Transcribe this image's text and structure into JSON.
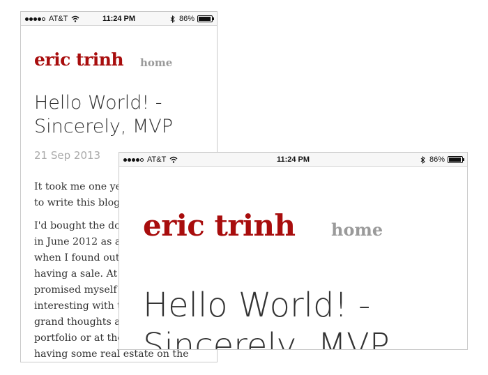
{
  "status_bar": {
    "carrier": "AT&T",
    "time": "11:24 PM",
    "battery_text": "86%",
    "battery_level_percent": 86,
    "signal_bars_filled": 4,
    "signal_bars_total": 5,
    "icons": [
      "signal-dots-icon",
      "wifi-icon",
      "bluetooth-icon",
      "battery-icon"
    ]
  },
  "site": {
    "title": "eric trinh",
    "nav_home": "home",
    "colors": {
      "title": "#a80d0d",
      "nav": "#9a9a9a",
      "text": "#333333",
      "date": "#aaaaaa"
    }
  },
  "post": {
    "title_line1": "Hello World! -",
    "title_line2": "Sincerely, MVP",
    "date": "21 Sep 2013",
    "paragraphs": [
      [
        "It took me one ye",
        "to write this blog"
      ],
      [
        "I'd bought the do",
        "in June 2012 as a",
        "when I found out",
        "having a sale.  At t",
        "promised myself",
        "interesting with t",
        "grand thoughts a",
        "portfolio or at the",
        "having some real estate on the"
      ]
    ]
  }
}
